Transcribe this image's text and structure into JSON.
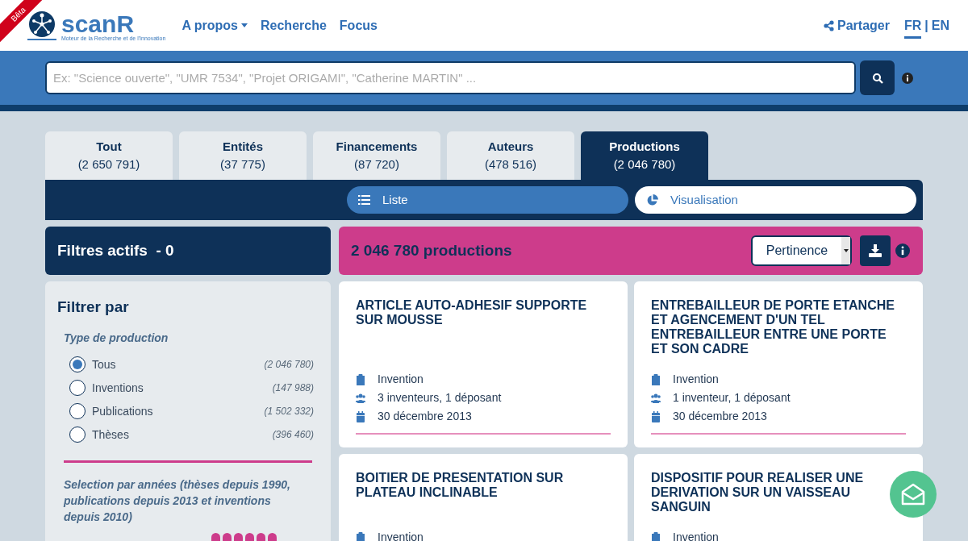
{
  "header": {
    "badge": "Bêta",
    "logo_text": "scanR",
    "logo_subtitle": "Moteur de la Recherche et de l'Innovation",
    "nav": [
      {
        "label": "A propos",
        "dropdown": true
      },
      {
        "label": "Recherche",
        "dropdown": false
      },
      {
        "label": "Focus",
        "dropdown": false
      }
    ],
    "share": "Partager",
    "languages": [
      {
        "label": "FR",
        "selected": true
      },
      {
        "label": "EN",
        "selected": false
      }
    ],
    "language_separator": "|"
  },
  "search": {
    "placeholder": "Ex: \"Science ouverte\", \"UMR 7534\", \"Projet ORIGAMI\", \"Catherine MARTIN\" ..."
  },
  "tabs": [
    {
      "label": "Tout",
      "count": "(2 650 791)",
      "selected": false
    },
    {
      "label": "Entités",
      "count": "(37 775)",
      "selected": false
    },
    {
      "label": "Financements",
      "count": "(87 720)",
      "selected": false
    },
    {
      "label": "Auteurs",
      "count": "(478 516)",
      "selected": false
    },
    {
      "label": "Productions",
      "count": "(2 046 780)",
      "selected": true
    }
  ],
  "views": [
    {
      "label": "Liste",
      "kind": "list",
      "selected": true
    },
    {
      "label": "Visualisation",
      "kind": "chart",
      "selected": false
    }
  ],
  "active_filters": "Filtres actifs  - 0",
  "results": {
    "count": "2 046 780 productions",
    "sort": "Pertinence"
  },
  "filters": {
    "title": "Filtrer par",
    "group_title": "Type de production",
    "options": [
      {
        "label": "Tous",
        "count": "(2 046 780)",
        "selected": true
      },
      {
        "label": "Inventions",
        "count": "(147 988)",
        "selected": false
      },
      {
        "label": "Publications",
        "count": "(1 502 332)",
        "selected": false
      },
      {
        "label": "Thèses",
        "count": "(396 460)",
        "selected": false
      }
    ],
    "years_title": "Selection par années (thèses depuis 1990, publications depuis 2013 et inventions depuis 2010)"
  },
  "cards": [
    {
      "title": "ARTICLE AUTO-ADHESIF SUPPORTE SUR MOUSSE",
      "type": "Invention",
      "people": "3 inventeurs, 1 déposant",
      "date": "30 décembre 2013"
    },
    {
      "title": "ENTREBAILLEUR DE PORTE ETANCHE ET AGENCEMENT D'UN TEL ENTREBAILLEUR ENTRE UNE PORTE ET SON CADRE",
      "type": "Invention",
      "people": "1 inventeur, 1 déposant",
      "date": "30 décembre 2013"
    },
    {
      "title": "BOITIER DE PRESENTATION SUR PLATEAU INCLINABLE",
      "type": "Invention"
    },
    {
      "title": "DISPOSITIF POUR REALISER UNE DERIVATION SUR UN VAISSEAU SANGUIN",
      "type": "Invention"
    }
  ]
}
